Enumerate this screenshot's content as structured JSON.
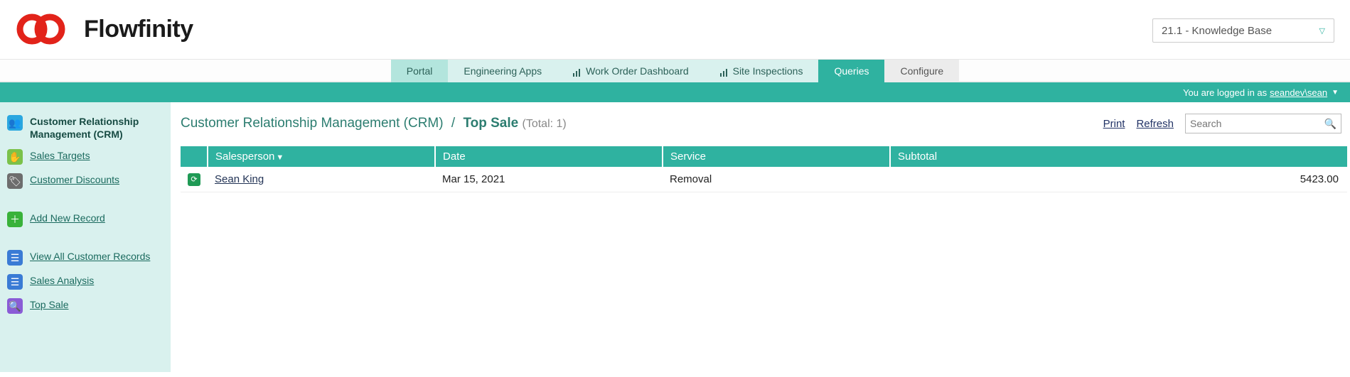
{
  "brand": "Flowfinity",
  "kb_selector": "21.1 - Knowledge Base",
  "nav": {
    "portal": "Portal",
    "eng": "Engineering Apps",
    "work": "Work Order Dashboard",
    "site": "Site Inspections",
    "queries": "Queries",
    "configure": "Configure"
  },
  "login": {
    "prefix": "You are logged in as",
    "user": "seandev\\sean"
  },
  "sidebar": {
    "crm": "Customer Relationship Management (CRM)",
    "sales_targets": "Sales Targets",
    "customer_discounts": "Customer Discounts",
    "add_new": "Add New Record",
    "view_all": "View All Customer Records",
    "sales_analysis": "Sales Analysis",
    "top_sale": "Top Sale"
  },
  "breadcrumb": {
    "root": "Customer Relationship Management (CRM)",
    "leaf": "Top Sale",
    "total_label": "(Total: 1)"
  },
  "actions": {
    "print": "Print",
    "refresh": "Refresh",
    "search_placeholder": "Search"
  },
  "table": {
    "headers": {
      "salesperson": "Salesperson",
      "date": "Date",
      "service": "Service",
      "subtotal": "Subtotal"
    },
    "rows": [
      {
        "salesperson": "Sean King",
        "date": "Mar 15, 2021",
        "service": "Removal",
        "subtotal": "5423.00"
      }
    ]
  }
}
